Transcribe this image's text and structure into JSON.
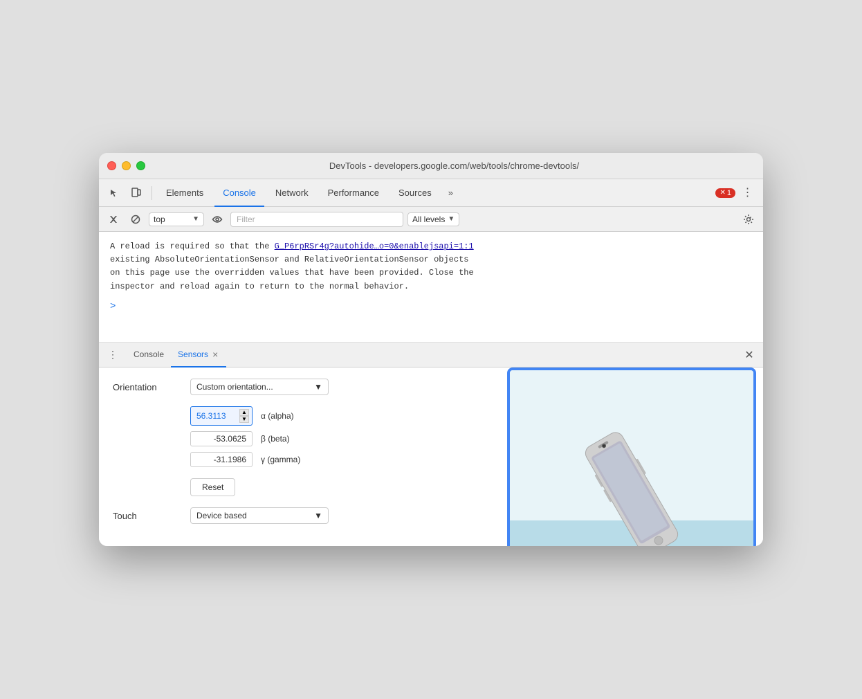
{
  "window": {
    "title": "DevTools - developers.google.com/web/tools/chrome-devtools/"
  },
  "toolbar": {
    "tabs": [
      {
        "id": "elements",
        "label": "Elements",
        "active": false
      },
      {
        "id": "console",
        "label": "Console",
        "active": true
      },
      {
        "id": "network",
        "label": "Network",
        "active": false
      },
      {
        "id": "performance",
        "label": "Performance",
        "active": false
      },
      {
        "id": "sources",
        "label": "Sources",
        "active": false
      }
    ],
    "more_label": "»",
    "error_count": "1"
  },
  "toolbar2": {
    "context_value": "top",
    "filter_placeholder": "Filter",
    "level_label": "All levels"
  },
  "console": {
    "message": "A reload is required so that the",
    "link_text": "G_P6rpRSr4g?autohide…o=0&enablejsapi=1:1",
    "message2": "existing AbsoluteOrientationSensor and RelativeOrientationSensor objects",
    "message3": "on this page use the overridden values that have been provided. Close the",
    "message4": "inspector and reload again to return to the normal behavior.",
    "prompt": ">"
  },
  "panel_tabs": {
    "console_label": "Console",
    "sensors_label": "Sensors",
    "sensors_close": "×"
  },
  "sensors": {
    "orientation_label": "Orientation",
    "dropdown_value": "Custom orientation...",
    "alpha_value": "56.3113",
    "alpha_label": "α (alpha)",
    "beta_value": "-53.0625",
    "beta_label": "β (beta)",
    "gamma_value": "-31.1986",
    "gamma_label": "γ (gamma)",
    "reset_label": "Reset",
    "touch_label": "Touch",
    "touch_dropdown": "Device based"
  }
}
